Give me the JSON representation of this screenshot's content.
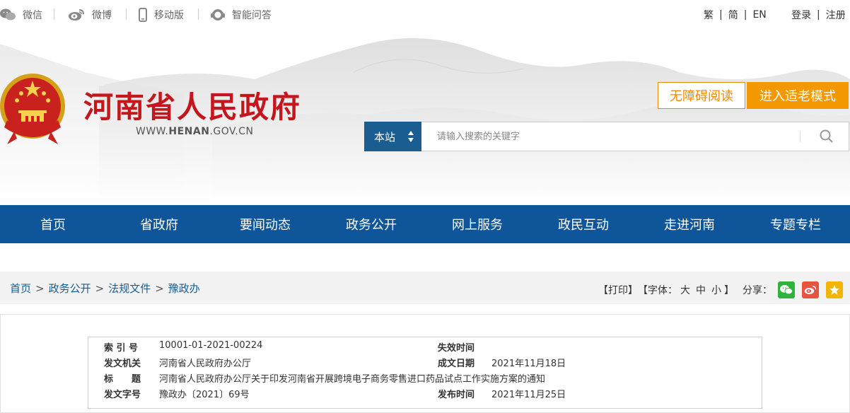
{
  "topbar": {
    "links": [
      {
        "label": "微信",
        "icon": "wechat-icon"
      },
      {
        "label": "微博",
        "icon": "weibo-icon"
      },
      {
        "label": "移动版",
        "icon": "mobile-icon"
      },
      {
        "label": "智能问答",
        "icon": "chat-bot-icon"
      }
    ],
    "lang": {
      "trad": "繁",
      "simp": "简",
      "en": "EN"
    },
    "auth": {
      "login": "登录",
      "register": "注册"
    }
  },
  "header": {
    "title": "河南省人民政府",
    "url_prefix": "WWW.",
    "url_bold": "HENAN",
    "url_suffix": ".GOV.CN",
    "accessible_label": "无障碍阅读",
    "elder_label": "进入适老模式"
  },
  "search": {
    "scope": "本站",
    "placeholder": "请输入搜索的关键字"
  },
  "nav": {
    "items": [
      "首页",
      "省政府",
      "要闻动态",
      "政务公开",
      "网上服务",
      "政民互动",
      "走进河南",
      "专题专栏"
    ]
  },
  "breadcrumb": {
    "items": [
      "首页",
      "政务公开",
      "法规文件",
      "豫政办"
    ],
    "sep": ">"
  },
  "tools": {
    "print": "【打印】",
    "font_prefix": "【字体：",
    "font_large": "大",
    "font_medium": "中",
    "font_small": "小",
    "font_suffix": "】",
    "share": "分享："
  },
  "meta": {
    "index_label": "索 引 号",
    "index_value": "10001-01-2021-00224",
    "expiry_label": "失效时间",
    "expiry_value": "",
    "issuer_label": "发文机关",
    "issuer_value": "河南省人民政府办公厅",
    "date_label": "成文日期",
    "date_value": "2021年11月18日",
    "title_label": "标　　题",
    "title_value": "河南省人民政府办公厅关于印发河南省开展跨境电子商务零售进口药品试点工作实施方案的通知",
    "docno_label": "发文字号",
    "docno_value": "豫政办〔2021〕69号",
    "publish_label": "发布时间",
    "publish_value": "2021年11月25日"
  },
  "colors": {
    "nav_blue": "#0f5599",
    "title_red": "#c4161c",
    "accent_orange": "#f39800"
  }
}
